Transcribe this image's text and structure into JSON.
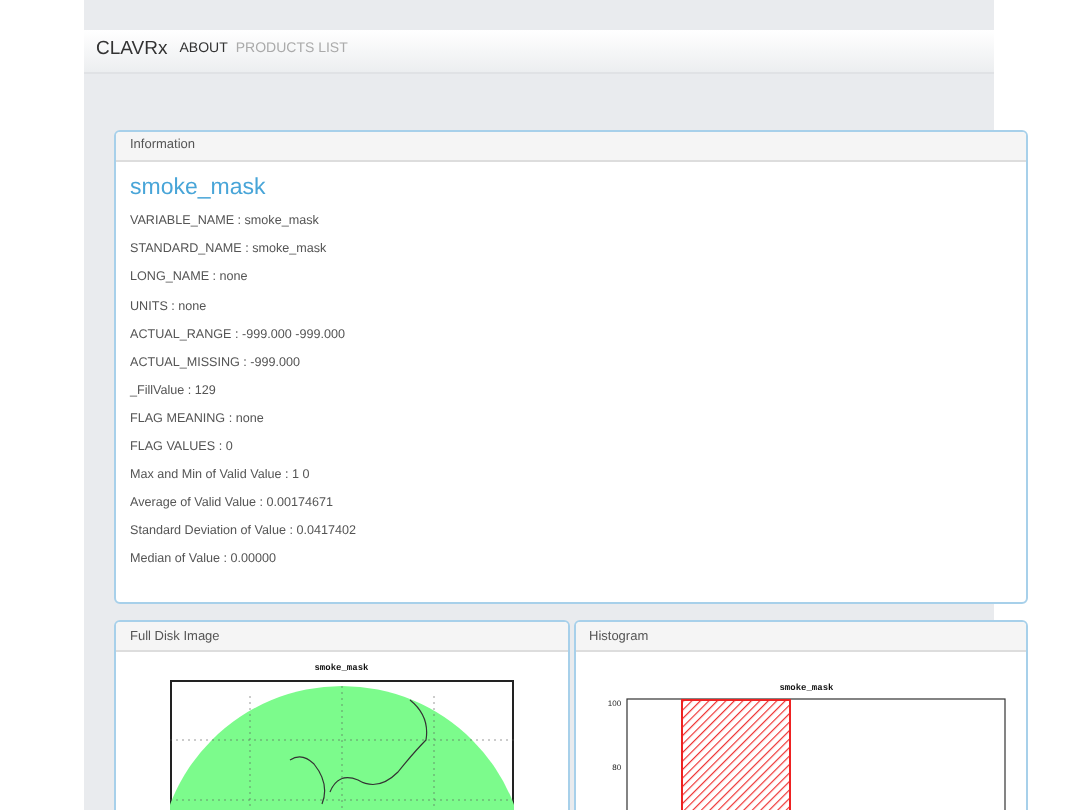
{
  "navbar": {
    "brand": "CLAVRx",
    "links": [
      {
        "label": "ABOUT",
        "selected": true
      },
      {
        "label": "PRODUCTS LIST",
        "selected": false
      }
    ]
  },
  "information": {
    "header": "Information",
    "title": "smoke_mask",
    "rows": [
      "VARIABLE_NAME : smoke_mask",
      "STANDARD_NAME : smoke_mask",
      "LONG_NAME : none",
      "UNITS : none",
      "ACTUAL_RANGE : -999.000 -999.000",
      "ACTUAL_MISSING : -999.000",
      "_FillValue : 129",
      "FLAG MEANING : none",
      "FLAG VALUES : 0",
      "Max and Min of Valid Value : 1 0",
      "Average of Valid Value : 0.00174671",
      "Standard Deviation of Value : 0.0417402",
      "Median of Value : 0.00000"
    ]
  },
  "full_disk_image": {
    "header": "Full Disk Image",
    "plot_title": "smoke_mask"
  },
  "histogram": {
    "header": "Histogram",
    "plot_title": "smoke_mask",
    "y_tick_labels": [
      "100",
      "80"
    ]
  }
}
